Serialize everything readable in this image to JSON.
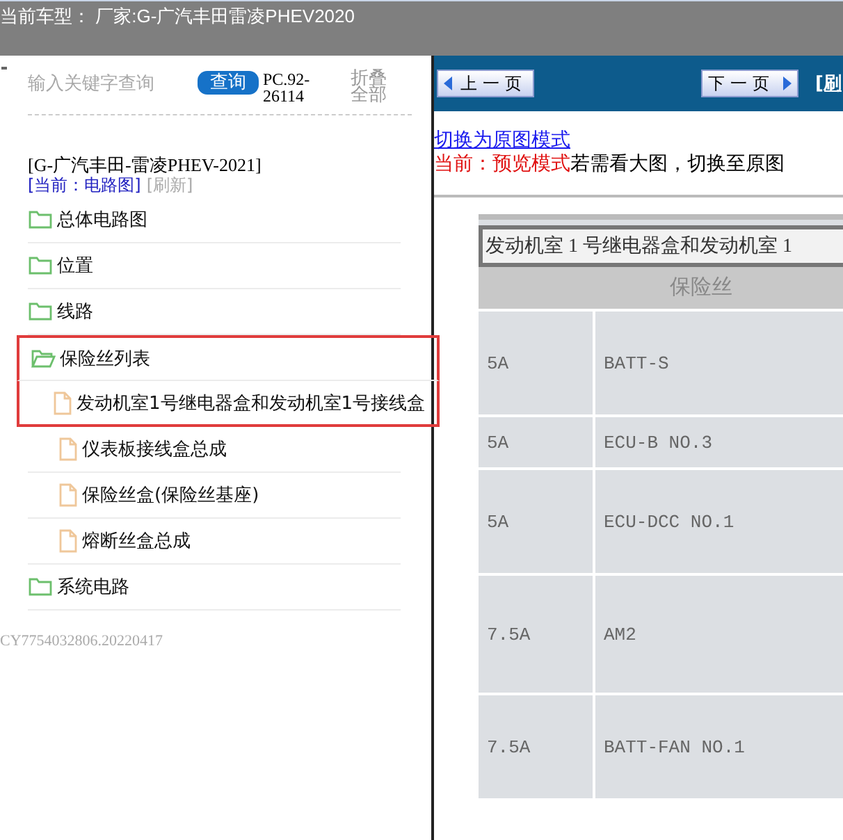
{
  "title_bar": {
    "text": "当前车型：  厂家:G-广汽丰田雷凌PHEV2020"
  },
  "sidebar": {
    "search": {
      "placeholder": "输入关键字查询"
    },
    "search_button": "查询",
    "code": "PC.92-26114",
    "collapse_all": "折叠全部",
    "model": "[G-广汽丰田-雷凌PHEV-2021]",
    "current": "[当前：电路图]",
    "refresh": "[刷新]",
    "tree": [
      {
        "label": "总体电路图",
        "expanded": false,
        "highlighted": false
      },
      {
        "label": "位置",
        "expanded": false,
        "highlighted": false
      },
      {
        "label": "线路",
        "expanded": false,
        "highlighted": false
      },
      {
        "label": "保险丝列表",
        "expanded": true,
        "highlighted": true,
        "children": [
          {
            "label": "发动机室1号继电器盒和发动机室1号接线盒",
            "highlighted": true
          },
          {
            "label": "仪表板接线盒总成",
            "highlighted": false
          },
          {
            "label": "保险丝盒(保险丝基座)",
            "highlighted": false
          },
          {
            "label": "熔断丝盒总成",
            "highlighted": false
          }
        ]
      },
      {
        "label": "系统电路",
        "expanded": false,
        "highlighted": false
      }
    ],
    "footer": "CY7754032806.20220417"
  },
  "viewer": {
    "prev_button": "上一页",
    "next_button": "下一页",
    "refresh_link": "[刷",
    "mode_link": "切换为原图模式",
    "mode_status": "当前：预览模式",
    "mode_hint": "若需看大图，切换至原图",
    "table": {
      "title": "发动机室 1 号继电器盒和发动机室 1",
      "header": "保险丝",
      "rows": [
        {
          "rating": "5A",
          "name": "BATT-S"
        },
        {
          "rating": "5A",
          "name": "ECU-B NO.3"
        },
        {
          "rating": "5A",
          "name": "ECU-DCC NO.1"
        },
        {
          "rating": "7.5A",
          "name": "AM2"
        },
        {
          "rating": "7.5A",
          "name": "BATT-FAN NO.1"
        }
      ]
    }
  }
}
